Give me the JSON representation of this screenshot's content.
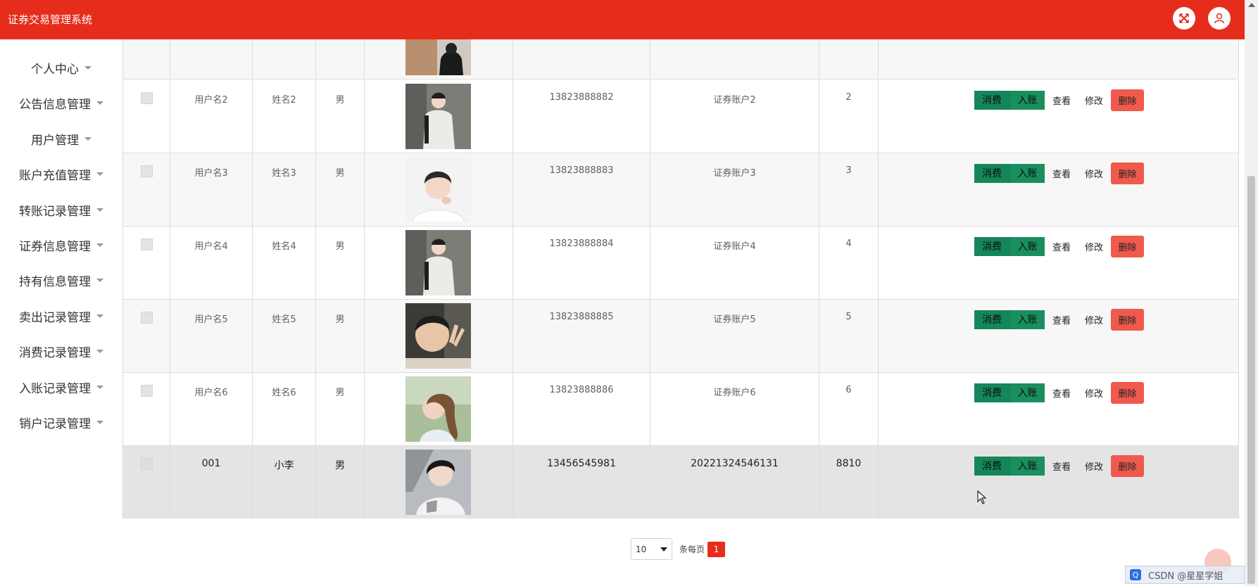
{
  "header": {
    "app_title": "证券交易管理系统",
    "fullscreen_icon": "fullscreen-icon",
    "user_icon": "user-avatar-icon"
  },
  "sidebar": {
    "items": [
      {
        "label": "个人中心"
      },
      {
        "label": "公告信息管理"
      },
      {
        "label": "用户管理"
      },
      {
        "label": "账户充值管理"
      },
      {
        "label": "转账记录管理"
      },
      {
        "label": "证券信息管理"
      },
      {
        "label": "持有信息管理"
      },
      {
        "label": "卖出记录管理"
      },
      {
        "label": "消费记录管理"
      },
      {
        "label": "入账记录管理"
      },
      {
        "label": "销户记录管理"
      }
    ]
  },
  "table": {
    "actions": {
      "consume": "消费",
      "credit": "入账",
      "view": "查看",
      "edit": "修改",
      "delete": "删除"
    },
    "rows": [
      {
        "username": "用户名2",
        "name": "姓名2",
        "gender": "男",
        "phone": "13823888882",
        "account": "证券账户2",
        "balance": "2",
        "photo": "person-standing-white-sweater"
      },
      {
        "username": "用户名3",
        "name": "姓名3",
        "gender": "男",
        "phone": "13823888883",
        "account": "证券账户3",
        "balance": "3",
        "photo": "person-portrait-white-shirt"
      },
      {
        "username": "用户名4",
        "name": "姓名4",
        "gender": "男",
        "phone": "13823888884",
        "account": "证券账户4",
        "balance": "4",
        "photo": "person-standing-white-sweater"
      },
      {
        "username": "用户名5",
        "name": "姓名5",
        "gender": "男",
        "phone": "13823888885",
        "account": "证券账户5",
        "balance": "5",
        "photo": "person-selfie-peace-sign"
      },
      {
        "username": "用户名6",
        "name": "姓名6",
        "gender": "男",
        "phone": "13823888886",
        "account": "证券账户6",
        "balance": "6",
        "photo": "person-outdoor-ponytail"
      },
      {
        "username": "001",
        "name": "小李",
        "gender": "男",
        "phone": "13456545981",
        "account": "20221324546131",
        "balance": "8810",
        "photo": "person-portrait-black-hair"
      }
    ]
  },
  "pagination": {
    "page_size": "10",
    "per_page_label": "条每页",
    "current_page": "1"
  },
  "colors": {
    "brand": "#e62d1b",
    "action_green": "#14875a",
    "delete_red": "#f05a4c"
  },
  "overlay": {
    "watermark": "CSDN @星星学姐"
  }
}
